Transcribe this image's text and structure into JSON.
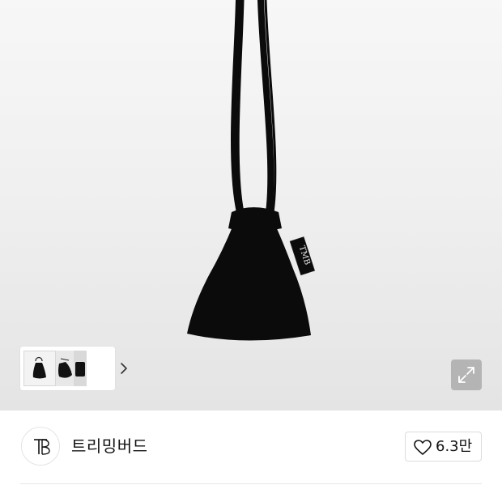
{
  "seller": {
    "brand_name": "트리밍버드",
    "logo_icon": "brand-logo-tb-icon"
  },
  "like": {
    "count": "6.3만",
    "icon": "heart-outline-icon"
  },
  "gallery": {
    "product_icon": "black-drawstring-pouch-bag",
    "tag_text": "TMB",
    "thumbnail_count": 3,
    "next_icon": "chevron-right-icon",
    "zoom_icon": "expand-arrows-icon"
  },
  "colors": {
    "bag": "#0b0b0b",
    "hero_bg": "#efefef",
    "border": "#dcdcdc"
  }
}
